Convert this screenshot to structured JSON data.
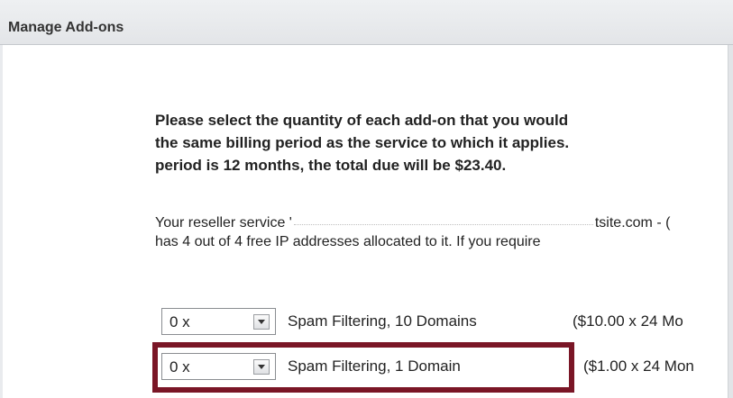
{
  "window": {
    "title": "Manage Add-ons"
  },
  "intro": {
    "lines": [
      "Please select the quantity of each add-on that you would",
      "the same billing period as the service to which it applies.",
      "period is 12 months, the total due will be $23.40."
    ]
  },
  "reseller": {
    "line1_prefix": "Your reseller service '",
    "line1_suffix": "tsite.com - (",
    "line2": "has 4 out of 4 free IP addresses allocated to it. If you require"
  },
  "addons": [
    {
      "quantity": "0 x",
      "name": "Spam Filtering, 10 Domains",
      "price": "($10.00 x 24 Mo"
    },
    {
      "quantity": "0 x",
      "name": "Spam Filtering, 1 Domain",
      "price": "($1.00 x 24 Mon"
    }
  ],
  "colors": {
    "highlight_border": "#7a1626",
    "titlebar_bg": "#e3e5e8"
  },
  "icons": {
    "dropdown_arrow": "chevron-down-icon"
  }
}
